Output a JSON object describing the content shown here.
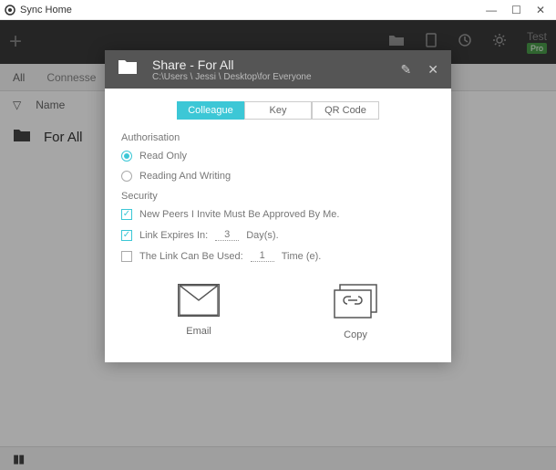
{
  "window": {
    "title": "Sync Home"
  },
  "toolbar": {
    "test": "Test",
    "pro": "Pro"
  },
  "filterbar": {
    "all": "All",
    "connesse": "Connesse"
  },
  "listheader": {
    "name": "Name"
  },
  "list": {
    "items": [
      {
        "name": "For All"
      }
    ]
  },
  "modal": {
    "title": "Share - For All",
    "path": "C:\\Users \\ Jessi \\ Desktop\\for Everyone",
    "tabs": {
      "colleague": "Colleague",
      "key": "Key",
      "qr": "QR Code"
    },
    "auth": {
      "label": "Authorisation",
      "readonly": "Read Only",
      "readwrite": "Reading And Writing"
    },
    "security": {
      "label": "Security",
      "approve": "New Peers I Invite Must Be Approved By Me.",
      "expires_pre": "Link Expires In:",
      "expires_val": "3",
      "expires_post": "Day(s).",
      "uses_pre": "The Link Can Be Used:",
      "uses_val": "1",
      "uses_post": "Time (e)."
    },
    "actions": {
      "email": "Email",
      "copy": "Copy"
    }
  }
}
